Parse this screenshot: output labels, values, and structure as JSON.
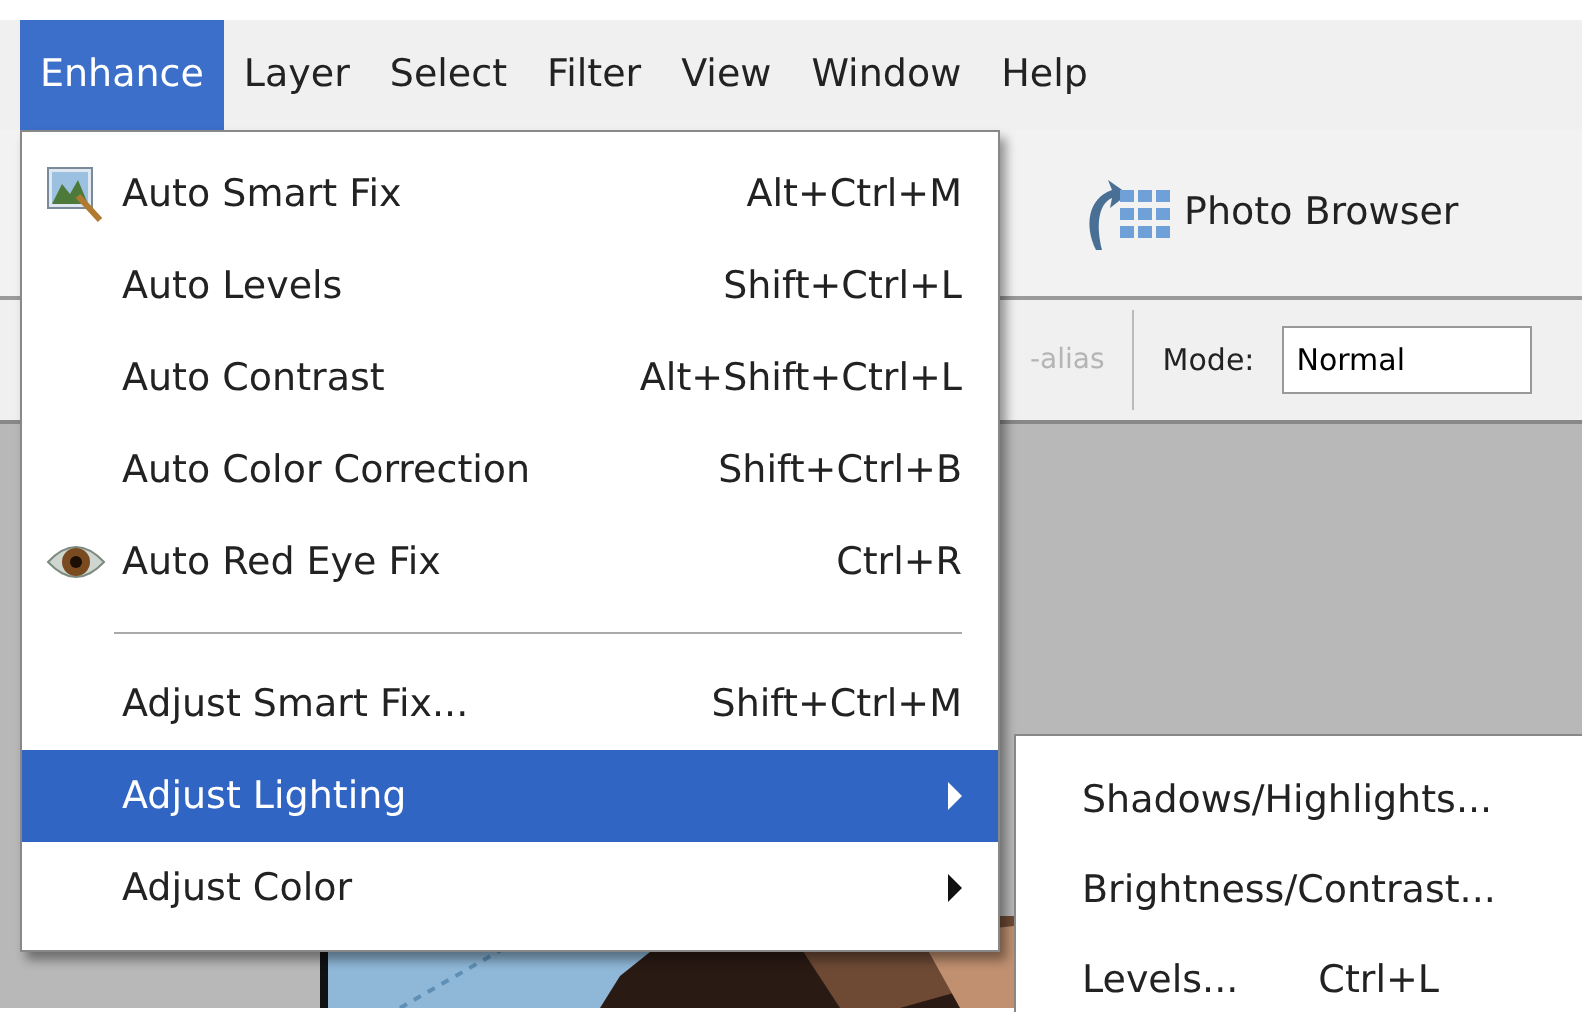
{
  "menu_bar": [
    {
      "label": "Enhance",
      "selected": true
    },
    {
      "label": "Layer",
      "selected": false
    },
    {
      "label": "Select",
      "selected": false
    },
    {
      "label": "Filter",
      "selected": false
    },
    {
      "label": "View",
      "selected": false
    },
    {
      "label": "Window",
      "selected": false
    },
    {
      "label": "Help",
      "selected": false
    }
  ],
  "toolbar": {
    "photo_browser": "Photo Browser",
    "anti_alias": {
      "label": "-alias",
      "disabled": true
    },
    "mode": {
      "label": "Mode:",
      "value": "Normal"
    }
  },
  "menu": {
    "items": [
      {
        "kind": "image_item",
        "label": "Auto Smart Fix",
        "shortcut": "Alt+Ctrl+M",
        "selected": false
      },
      {
        "kind": "item",
        "label": "Auto Levels",
        "shortcut": "Shift+Ctrl+L",
        "selected": false
      },
      {
        "kind": "item",
        "label": "Auto Contrast",
        "shortcut": "Alt+Shift+Ctrl+L",
        "selected": false
      },
      {
        "kind": "item",
        "label": "Auto Color Correction",
        "shortcut": "Shift+Ctrl+B",
        "selected": false
      },
      {
        "kind": "eye_item",
        "label": "Auto Red Eye Fix",
        "shortcut": "Ctrl+R",
        "selected": false
      },
      {
        "kind": "separator"
      },
      {
        "kind": "item",
        "label": "Adjust Smart Fix...",
        "shortcut": "Shift+Ctrl+M",
        "selected": false
      },
      {
        "kind": "submenu_item",
        "label": "Adjust Lighting",
        "selected": true
      },
      {
        "kind": "submenu_item",
        "label": "Adjust Color",
        "selected": false
      }
    ]
  },
  "submenu": {
    "items": [
      {
        "label": "Shadows/Highlights..."
      },
      {
        "label": "Brightness/Contrast..."
      },
      {
        "label": "Levels...",
        "shortcut": "Ctrl+L"
      }
    ]
  }
}
